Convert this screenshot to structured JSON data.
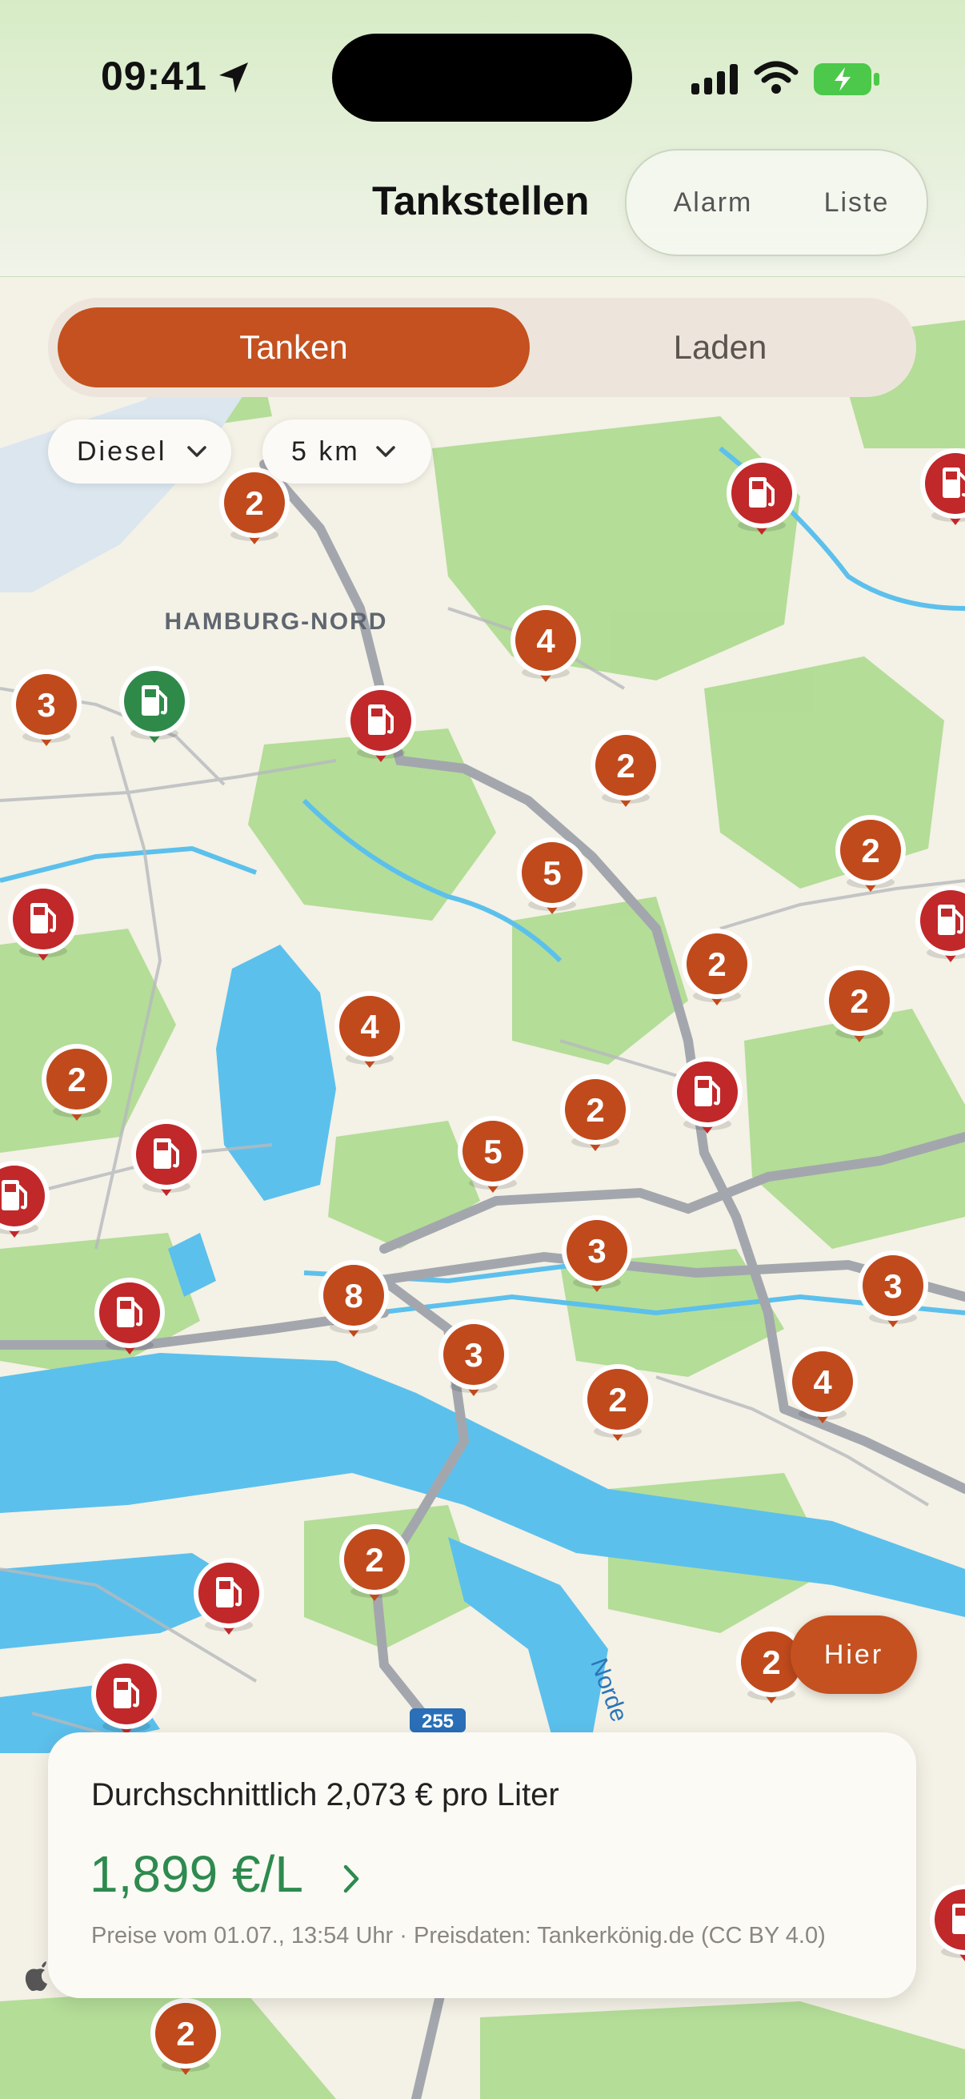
{
  "status_bar": {
    "time": "09:41"
  },
  "nav": {
    "title": "Tankstellen",
    "alarm_label": "Alarm",
    "list_label": "Liste"
  },
  "segment": {
    "active": "Tanken",
    "inactive": "Laden"
  },
  "filters": {
    "fuel": "Diesel",
    "radius": "5 km"
  },
  "map": {
    "district_label": "HAMBURG-NORD",
    "road_badge": "255",
    "river_label": "Norde",
    "markers": [
      {
        "kind": "count",
        "value": "2"
      },
      {
        "kind": "pump",
        "color": "red"
      },
      {
        "kind": "pump",
        "color": "red"
      },
      {
        "kind": "count",
        "value": "4"
      },
      {
        "kind": "count",
        "value": "3"
      },
      {
        "kind": "pump",
        "color": "green"
      },
      {
        "kind": "pump",
        "color": "red"
      },
      {
        "kind": "count",
        "value": "2"
      },
      {
        "kind": "count",
        "value": "5"
      },
      {
        "kind": "count",
        "value": "2"
      },
      {
        "kind": "pump",
        "color": "red"
      },
      {
        "kind": "pump",
        "color": "red"
      },
      {
        "kind": "count",
        "value": "2"
      },
      {
        "kind": "count",
        "value": "2"
      },
      {
        "kind": "count",
        "value": "4"
      },
      {
        "kind": "count",
        "value": "2"
      },
      {
        "kind": "pump",
        "color": "red"
      },
      {
        "kind": "count",
        "value": "2"
      },
      {
        "kind": "pump",
        "color": "red"
      },
      {
        "kind": "count",
        "value": "5"
      },
      {
        "kind": "pump",
        "color": "red"
      },
      {
        "kind": "count",
        "value": "3"
      },
      {
        "kind": "count",
        "value": "3"
      },
      {
        "kind": "pump",
        "color": "red"
      },
      {
        "kind": "count",
        "value": "8"
      },
      {
        "kind": "count",
        "value": "3"
      },
      {
        "kind": "count",
        "value": "4"
      },
      {
        "kind": "count",
        "value": "2"
      },
      {
        "kind": "count",
        "value": "2"
      },
      {
        "kind": "pump",
        "color": "red"
      },
      {
        "kind": "count",
        "value": "2"
      },
      {
        "kind": "pump",
        "color": "red"
      },
      {
        "kind": "pump",
        "color": "red"
      },
      {
        "kind": "count",
        "value": "2"
      }
    ]
  },
  "locate_button": "Hier",
  "summary": {
    "average": "Durchschnittlich 2,073 € pro Liter",
    "best_price": "1,899 €/L",
    "footer": "Preise vom 01.07., 13:54 Uhr · Preisdaten: Tankerkönig.de (CC BY 4.0)"
  },
  "colors": {
    "accent": "#c4511f",
    "marker_count": "#c04a1c",
    "marker_red": "#c0282a",
    "marker_green": "#2f8a4a",
    "price_green": "#2e8a4e",
    "water": "#5cc0ec",
    "park": "#a8d98a",
    "road": "#a3a7ad"
  }
}
